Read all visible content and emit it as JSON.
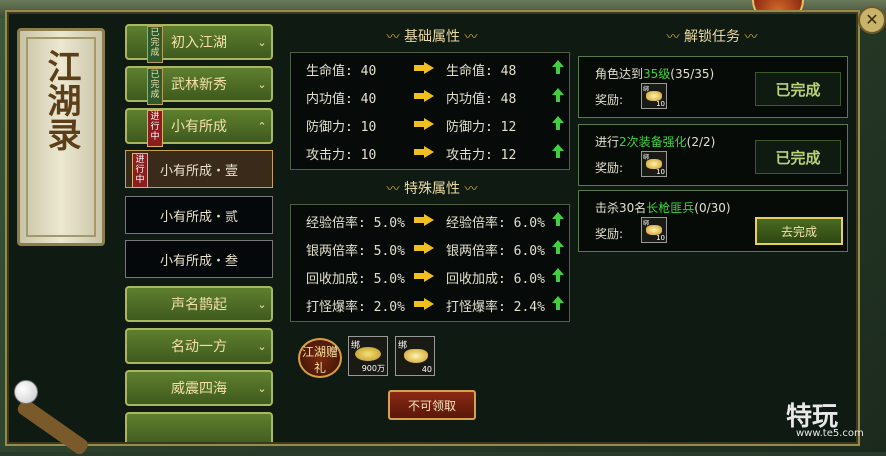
{
  "scroll_title": "江湖录",
  "close_label": "✕",
  "menu": {
    "items": [
      {
        "label": "初入江湖",
        "tag": "已完成"
      },
      {
        "label": "武林新秀",
        "tag": "已完成"
      },
      {
        "label": "小有所成",
        "tag": "进行中"
      }
    ],
    "subitems": [
      {
        "label": "小有所成・壹",
        "tag": "进行中"
      },
      {
        "label": "小有所成・贰"
      },
      {
        "label": "小有所成・叁"
      }
    ],
    "more_items": [
      {
        "label": "声名鹊起"
      },
      {
        "label": "名动一方"
      },
      {
        "label": "威震四海"
      }
    ]
  },
  "basic": {
    "header": "基础属性",
    "rows": [
      {
        "label": "生命值:",
        "from": "40",
        "to": "48"
      },
      {
        "label": "内功值:",
        "from": "40",
        "to": "48"
      },
      {
        "label": "防御力:",
        "from": "10",
        "to": "12"
      },
      {
        "label": "攻击力:",
        "from": "10",
        "to": "12"
      }
    ]
  },
  "special": {
    "header": "特殊属性",
    "rows": [
      {
        "label": "经验倍率:",
        "from": "5.0%",
        "to": "6.0%"
      },
      {
        "label": "银两倍率:",
        "from": "5.0%",
        "to": "6.0%"
      },
      {
        "label": "回收加成:",
        "from": "5.0%",
        "to": "6.0%"
      },
      {
        "label": "打怪爆率:",
        "from": "2.0%",
        "to": "2.4%"
      }
    ]
  },
  "gift": {
    "badge": "江湖赠礼",
    "items": [
      {
        "lock": "绑",
        "qty": "900万"
      },
      {
        "lock": "绑",
        "qty": "40"
      }
    ],
    "button": "不可领取"
  },
  "tasks": {
    "header": "解锁任务",
    "reward_label": "奖励:",
    "list": [
      {
        "pre": "角色达到",
        "hl": "35级",
        "post": "(35/35)",
        "qty": "10",
        "lock": "绑",
        "button": "已完成",
        "state": "done"
      },
      {
        "pre": "进行",
        "hl": "2次装备强化",
        "post": "(2/2)",
        "qty": "10",
        "lock": "绑",
        "button": "已完成",
        "state": "done"
      },
      {
        "pre": "击杀30名",
        "hl": "长枪匪兵",
        "post": "(0/30)",
        "qty": "10",
        "lock": "绑",
        "button": "去完成",
        "state": "go"
      }
    ]
  },
  "watermark": {
    "main": "特玩",
    "sub": "www.te5.com"
  },
  "colors": {
    "frame_gold": "#9a8a4a",
    "btn_green": "#4a6a20",
    "highlight_green": "#3fd040",
    "arrow_yellow": "#f0c020"
  }
}
